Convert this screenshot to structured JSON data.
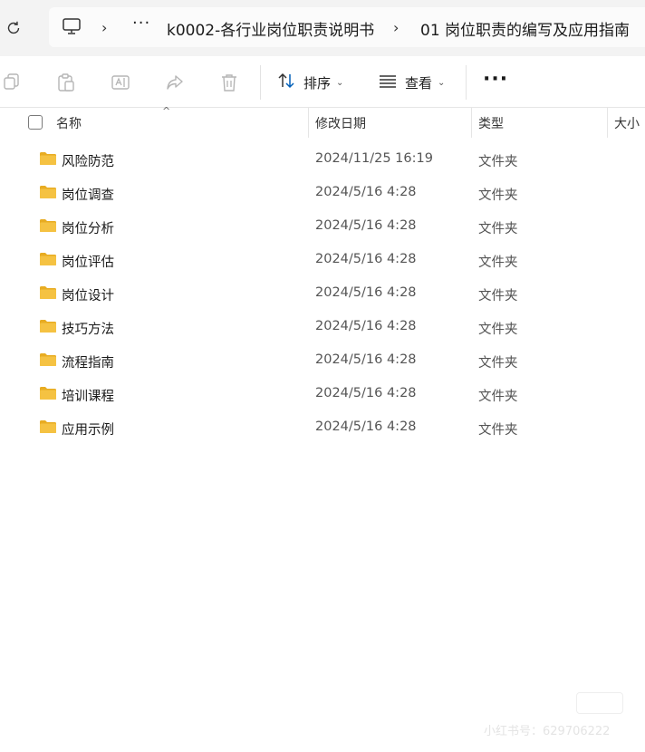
{
  "address_bar": {
    "ellipsis": "···",
    "breadcrumbs": [
      {
        "label": "k0002-各行业岗位职责说明书"
      },
      {
        "label": "01 岗位职责的编写及应用指南"
      }
    ]
  },
  "toolbar": {
    "sort_label": "排序",
    "view_label": "查看",
    "more_label": "···"
  },
  "columns": {
    "name": "名称",
    "modified": "修改日期",
    "type": "类型",
    "size": "大小"
  },
  "files": [
    {
      "name": "风险防范",
      "modified": "2024/11/25 16:19",
      "type": "文件夹"
    },
    {
      "name": "岗位调查",
      "modified": "2024/5/16 4:28",
      "type": "文件夹"
    },
    {
      "name": "岗位分析",
      "modified": "2024/5/16 4:28",
      "type": "文件夹"
    },
    {
      "name": "岗位评估",
      "modified": "2024/5/16 4:28",
      "type": "文件夹"
    },
    {
      "name": "岗位设计",
      "modified": "2024/5/16 4:28",
      "type": "文件夹"
    },
    {
      "name": "技巧方法",
      "modified": "2024/5/16 4:28",
      "type": "文件夹"
    },
    {
      "name": "流程指南",
      "modified": "2024/5/16 4:28",
      "type": "文件夹"
    },
    {
      "name": "培训课程",
      "modified": "2024/5/16 4:28",
      "type": "文件夹"
    },
    {
      "name": "应用示例",
      "modified": "2024/5/16 4:28",
      "type": "文件夹"
    }
  ],
  "watermark": {
    "text": "小红书号：629706222"
  },
  "colors": {
    "folder": "#f5c242",
    "folder_dark": "#e8ac22",
    "accent": "#005fb8"
  },
  "icons": {
    "refresh": "refresh-icon",
    "computer": "computer-icon",
    "copy": "copy-icon",
    "paste": "paste-icon",
    "rename": "rename-icon",
    "share": "share-icon",
    "delete": "delete-icon",
    "sort": "sort-icon",
    "view": "view-icon",
    "folder": "folder-icon"
  }
}
